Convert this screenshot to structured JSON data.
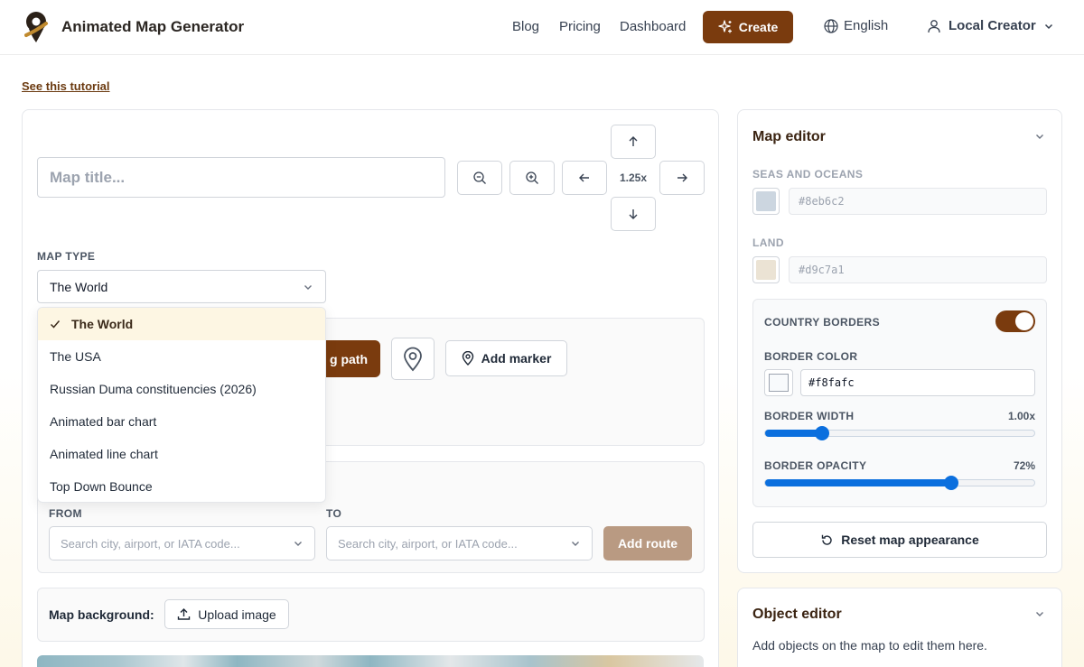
{
  "header": {
    "app_title": "Animated Map Generator",
    "nav": [
      "Blog",
      "Pricing",
      "Dashboard"
    ],
    "create_label": "Create",
    "language": "English",
    "user_name": "Local Creator"
  },
  "tutorial_link": "See this tutorial",
  "editor": {
    "title_placeholder": "Map title...",
    "zoom_level": "1.25x",
    "map_type_label": "MAP TYPE",
    "map_type_selected": "The World",
    "map_type_options": [
      "The World",
      "The USA",
      "Russian Duma constituencies (2026)",
      "Animated bar chart",
      "Animated line chart",
      "Top Down Bounce"
    ],
    "path_button_partial": "g path",
    "add_marker_label": "Add marker",
    "route": {
      "from_label": "FROM",
      "to_label": "TO",
      "from_placeholder": "Search city, airport, or IATA code...",
      "to_placeholder": "Search city, airport, or IATA code...",
      "add_route_label": "Add route"
    },
    "background_label": "Map background:",
    "upload_label": "Upload image"
  },
  "map_editor": {
    "title": "Map editor",
    "seas_label": "SEAS AND OCEANS",
    "seas_hex": "#8eb6c2",
    "land_label": "LAND",
    "land_hex": "#d9c7a1",
    "country_borders_label": "COUNTRY BORDERS",
    "country_borders_on": true,
    "border_color_label": "BORDER COLOR",
    "border_color_hex": "#f8fafc",
    "border_width_label": "BORDER WIDTH",
    "border_width_value": "1.00x",
    "border_width_fraction": 0.21,
    "border_opacity_label": "BORDER OPACITY",
    "border_opacity_value": "72%",
    "border_opacity_fraction": 0.69,
    "reset_label": "Reset map appearance"
  },
  "object_editor": {
    "title": "Object editor",
    "hint": "Add objects on the map to edit them here."
  },
  "colors": {
    "accent": "#7a3b0e",
    "slider": "#0b6fde",
    "route_button": "#b99a82"
  }
}
